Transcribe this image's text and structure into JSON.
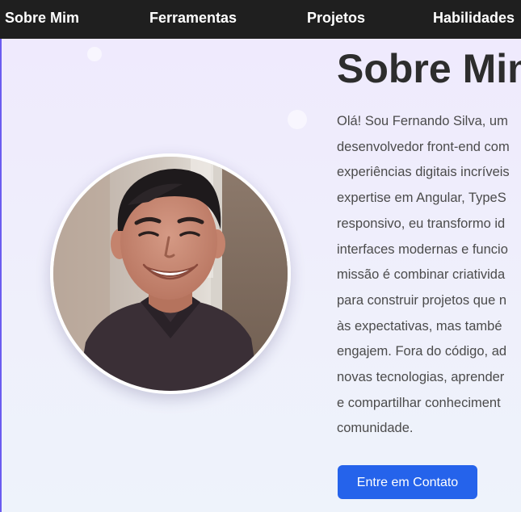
{
  "nav": {
    "items": [
      {
        "label": "Sobre Mim"
      },
      {
        "label": "Ferramentas"
      },
      {
        "label": "Projetos"
      },
      {
        "label": "Habilidades"
      }
    ]
  },
  "about": {
    "title": "Sobre Mim",
    "bio_lines": [
      "Olá! Sou Fernando Silva, um",
      "desenvolvedor front-end com",
      "experiências digitais incríveis",
      "expertise em Angular, TypeS",
      "responsivo, eu transformo id",
      "interfaces modernas e funcio",
      "missão é combinar criativida",
      "para construir projetos que n",
      "às expectativas, mas també",
      "engajem. Fora do código, ad",
      "novas tecnologias, aprender",
      "e compartilhar conheciment",
      "comunidade."
    ],
    "cta_label": "Entre em Contato"
  },
  "colors": {
    "navbar_bg": "#1f1f1f",
    "accent_blue": "#2563eb",
    "page_bg": "#eeeafc"
  }
}
